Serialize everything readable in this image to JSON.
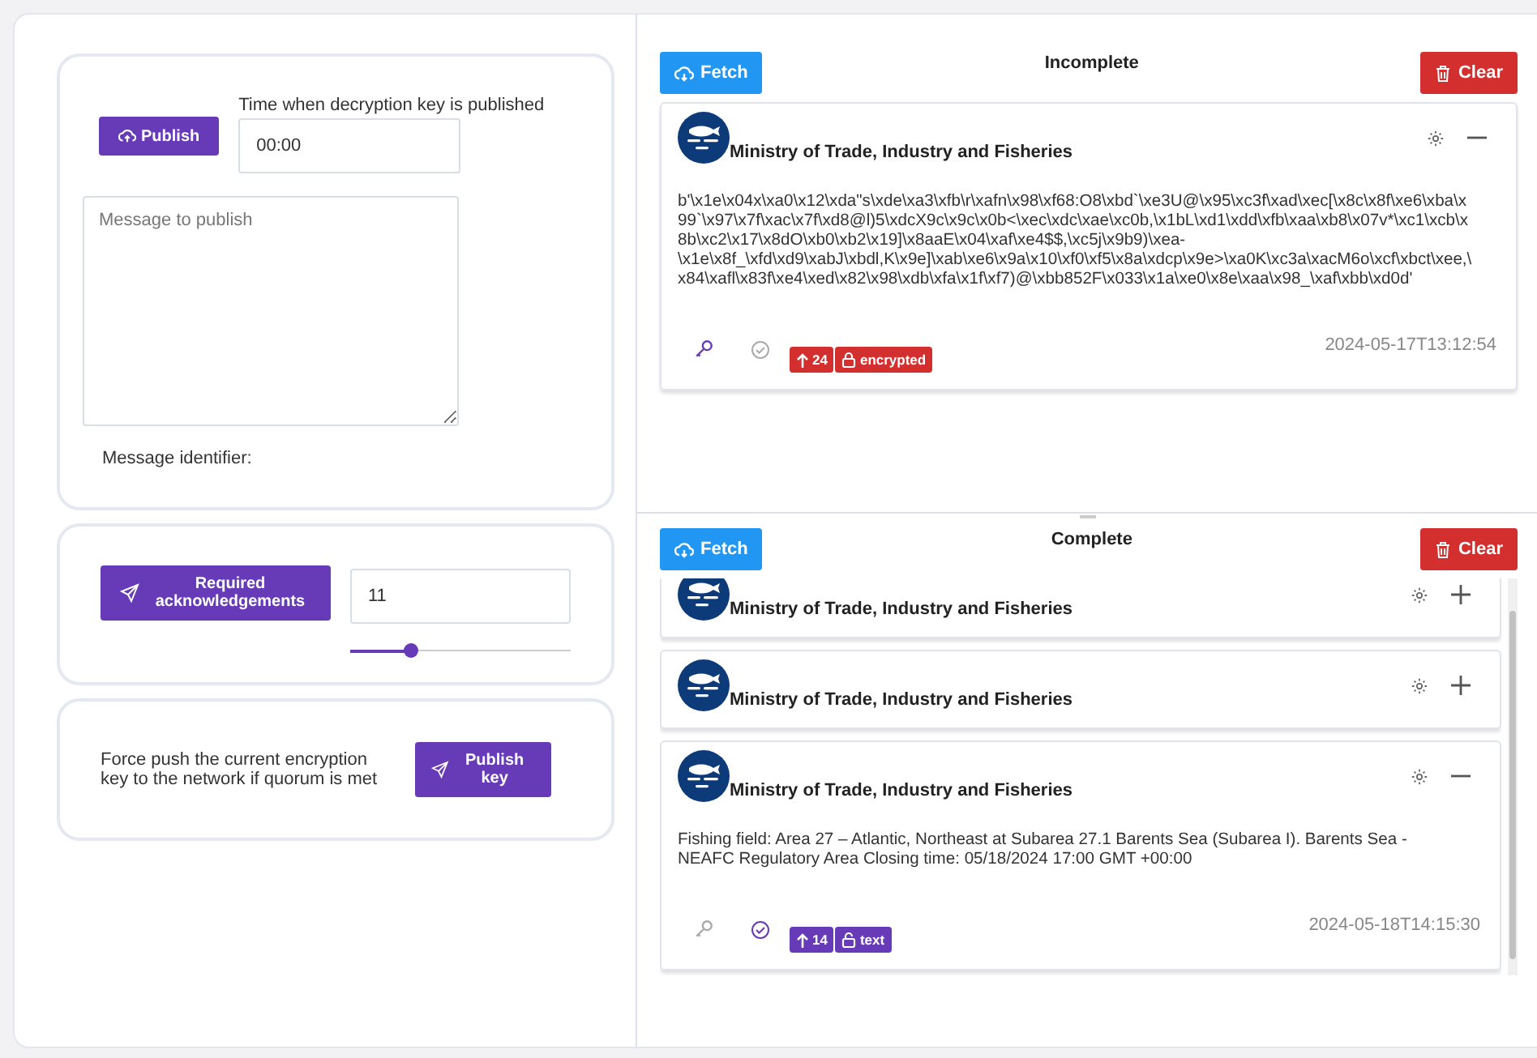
{
  "publish": {
    "button": "Publish",
    "time_label": "Time when decryption key is published",
    "time_value": "00:00",
    "message_placeholder": "Message to publish",
    "identifier_label": "Message identifier:"
  },
  "acknowledgements": {
    "button": "Required acknowledgements",
    "value": "11",
    "level": 0.27
  },
  "force_push": {
    "text": "Force push the current encryption key to the network if quorum is met",
    "button": "Publish key"
  },
  "sections": [
    {
      "title": "Incomplete",
      "fetch": "Fetch",
      "clear": "Clear",
      "scrollbar": false,
      "messages": [
        {
          "sender": "Ministry of Trade, Industry and Fisheries",
          "expanded": true,
          "body": "b'\\x1e\\x04x\\xa0\\x12\\xda\"s\\xde\\xa3\\xfb\\r\\xafn\\x98\\xf68:O8\\xbd`\\xe3U@\\x95\\xc3f\\xad\\xec[\\x8c\\x8f\\xe6\\xba\\x99`\\x97\\x7f\\xac\\x7f\\xd8@l)5\\xdcX9c\\x9c\\x0b<\\xec\\xdc\\xae\\xc0b,\\x1bL\\xd1\\xdd\\xfb\\xaa\\xb8\\x07v*\\xc1\\xcb\\x8b\\xc2\\x17\\x8dO\\xb0\\xb2\\x19]\\x8aaE\\x04\\xaf\\xe4$$,\\xc5j\\x9b9)\\xea-\\x1e\\x8f_\\xfd\\xd9\\xabJ\\xbdl,K\\x9e]\\xab\\xe6\\x9a\\x10\\xf0\\xf5\\x8a\\xdcp\\x9e>\\xa0K\\xc3a\\xacM6o\\xcf\\xbct\\xee,\\x84\\xafl\\x83f\\xe4\\xed\\x82\\x98\\xdb\\xfa\\x1f\\xf7)@\\xbb852F\\x033\\x1a\\xe0\\x8e\\xaa\\x98_\\xaf\\xbb\\xd0d'",
          "timestamp": "2024-05-17T13:12:54",
          "key_active": true,
          "verified": false,
          "count": "24",
          "kind": "encrypted",
          "badge": "encrypted"
        }
      ]
    },
    {
      "title": "Complete",
      "fetch": "Fetch",
      "clear": "Clear",
      "scrollbar": true,
      "messages": [
        {
          "sender": "Ministry of Trade, Industry and Fisheries",
          "expanded": false
        },
        {
          "sender": "Ministry of Trade, Industry and Fisheries",
          "expanded": false
        },
        {
          "sender": "Ministry of Trade, Industry and Fisheries",
          "expanded": true,
          "body": "Fishing field: Area 27 – Atlantic, Northeast at Subarea 27.1 Barents Sea (Subarea I). Barents Sea - NEAFC Regulatory Area Closing time: 05/18/2024 17:00 GMT +00:00",
          "timestamp": "2024-05-18T14:15:30",
          "key_active": false,
          "verified": true,
          "count": "14",
          "kind": "text",
          "badge": "text"
        }
      ]
    }
  ]
}
